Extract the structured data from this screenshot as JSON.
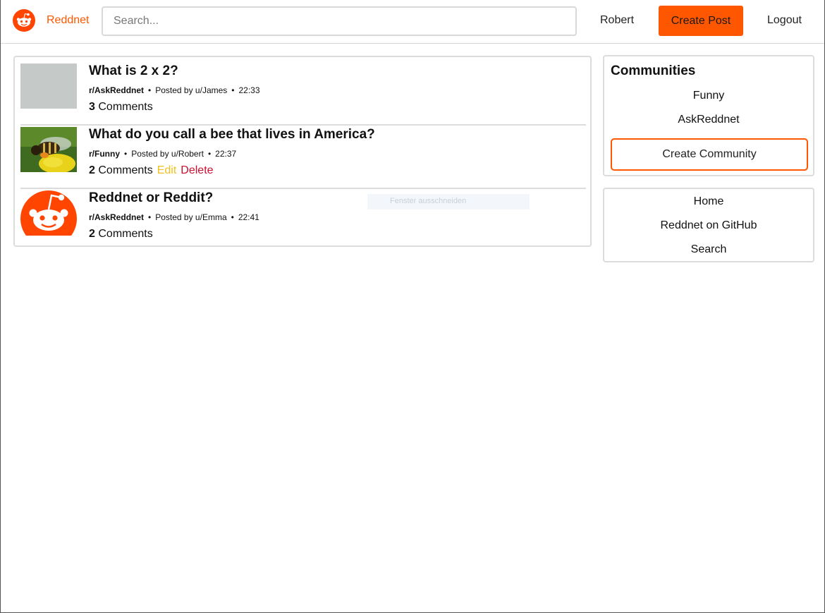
{
  "navbar": {
    "brand": "Reddnet",
    "search_placeholder": "Search...",
    "user": "Robert",
    "create_post_label": "Create Post",
    "logout_label": "Logout",
    "accent_color": "#ff5700"
  },
  "posts": [
    {
      "title": "What is 2 x 2?",
      "community": "r/AskReddnet",
      "posted_by": "Posted by u/James",
      "time": "22:33",
      "comment_count": "3",
      "comments_label": "Comments",
      "thumbnail": "blank-placeholder"
    },
    {
      "title": "What do you call a bee that lives in America?",
      "community": "r/Funny",
      "posted_by": "Posted by u/Robert",
      "time": "22:37",
      "comment_count": "2",
      "comments_label": "Comments",
      "edit_label": "Edit",
      "delete_label": "Delete",
      "thumbnail": "bee-photo"
    },
    {
      "title": "Reddnet or Reddit?",
      "community": "r/AskReddnet",
      "posted_by": "Posted by u/Emma",
      "time": "22:41",
      "comment_count": "2",
      "comments_label": "Comments",
      "thumbnail": "reddit-logo"
    }
  ],
  "overlay": {
    "tooltip_text": "Fenster ausschneiden"
  },
  "sidebar": {
    "communities_title": "Communities",
    "communities": [
      "Funny",
      "AskReddnet"
    ],
    "create_community_label": "Create Community",
    "links": [
      "Home",
      "Reddnet on GitHub",
      "Search"
    ]
  }
}
